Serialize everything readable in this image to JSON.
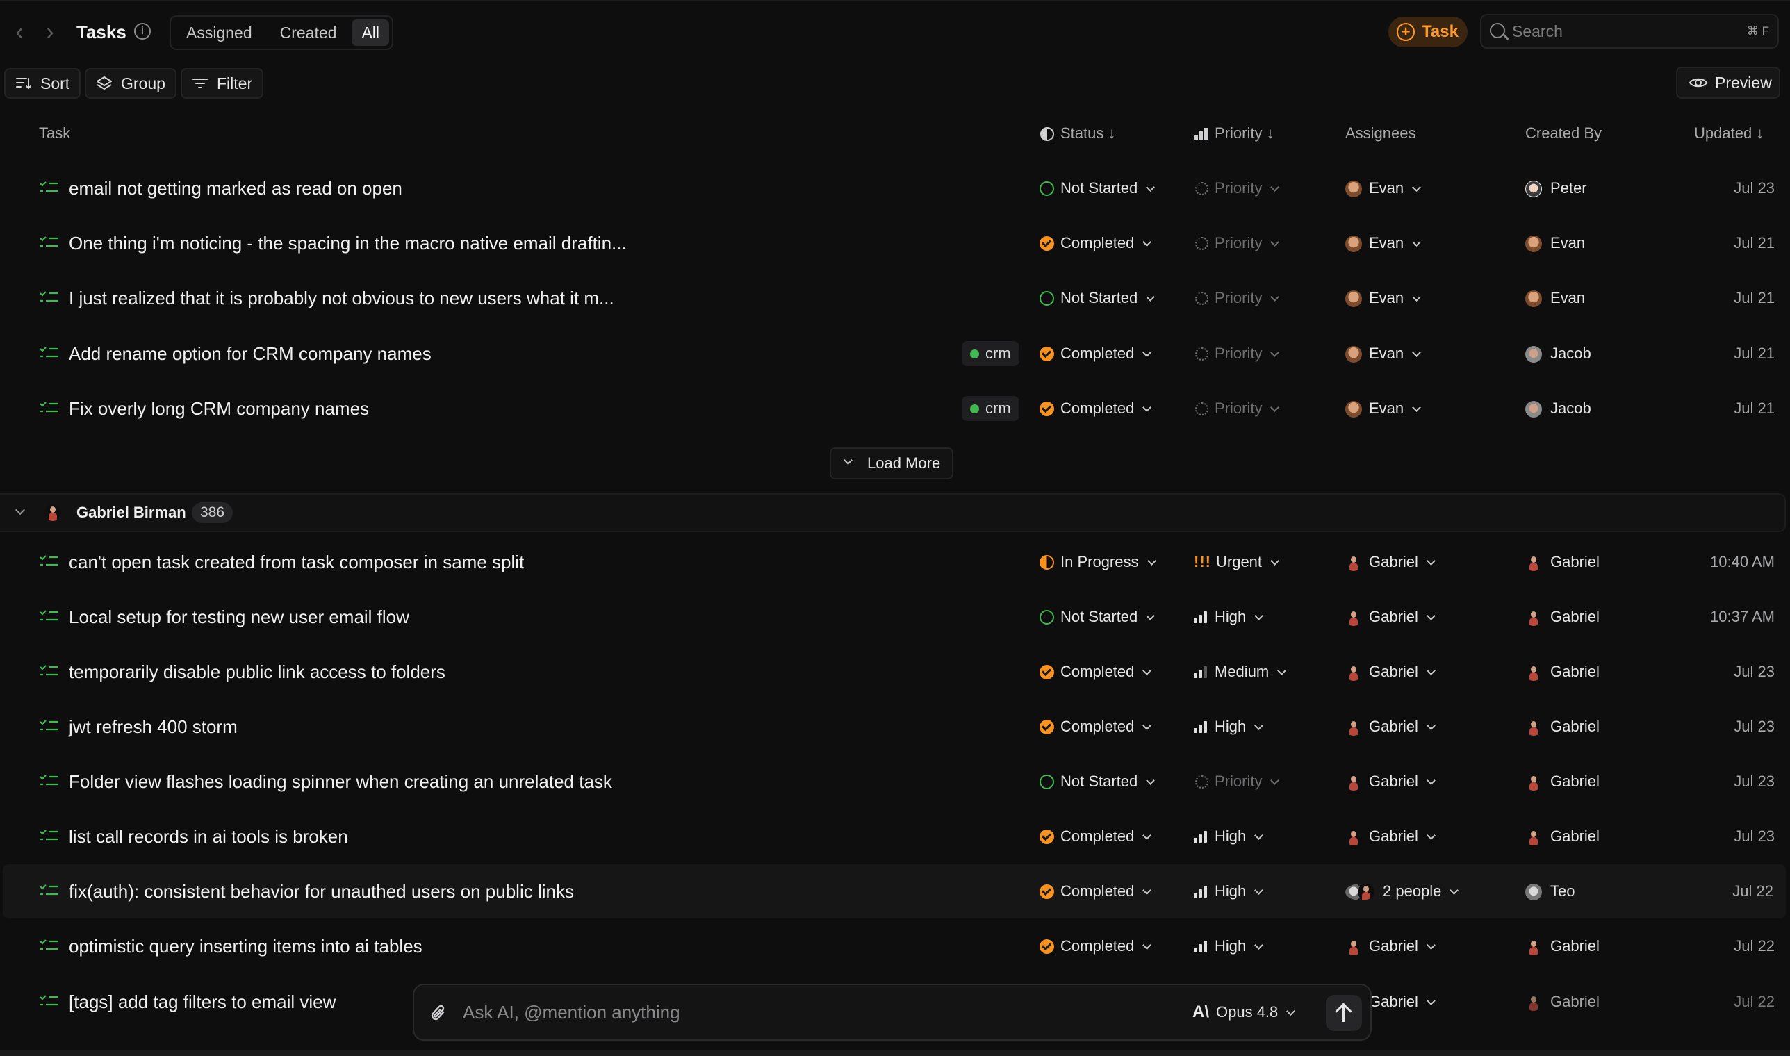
{
  "header": {
    "title": "Tasks",
    "tabs": [
      "Assigned",
      "Created",
      "All"
    ],
    "active_tab": "All",
    "new_task_label": "Task",
    "search_placeholder": "Search",
    "search_shortcut": "⌘ F"
  },
  "toolbar": {
    "sort_label": "Sort",
    "group_label": "Group",
    "filter_label": "Filter",
    "preview_label": "Preview"
  },
  "columns": {
    "task": "Task",
    "status": "Status",
    "priority": "Priority",
    "assignees": "Assignees",
    "created_by": "Created By",
    "updated": "Updated"
  },
  "group1_rows": [
    {
      "title": "email not getting marked as read on open",
      "tag": "",
      "status": "Not Started",
      "priority": "Priority",
      "assignee": "Evan",
      "creator": "Peter",
      "updated": "Jul 23"
    },
    {
      "title": "One thing i'm noticing - the spacing in the macro native email draftin...",
      "tag": "",
      "status": "Completed",
      "priority": "Priority",
      "assignee": "Evan",
      "creator": "Evan",
      "updated": "Jul 21"
    },
    {
      "title": "I just realized that it is probably not obvious to new users what it m...",
      "tag": "",
      "status": "Not Started",
      "priority": "Priority",
      "assignee": "Evan",
      "creator": "Evan",
      "updated": "Jul 21"
    },
    {
      "title": "Add rename option for CRM company names",
      "tag": "crm",
      "status": "Completed",
      "priority": "Priority",
      "assignee": "Evan",
      "creator": "Jacob",
      "updated": "Jul 21"
    },
    {
      "title": "Fix overly long CRM company names",
      "tag": "crm",
      "status": "Completed",
      "priority": "Priority",
      "assignee": "Evan",
      "creator": "Jacob",
      "updated": "Jul 21"
    }
  ],
  "load_more_label": "Load More",
  "group2": {
    "name": "Gabriel Birman",
    "count": "386"
  },
  "group2_rows": [
    {
      "title": "can't open task created from task composer in same split",
      "status": "In Progress",
      "priority_marker": "!!!",
      "priority": "Urgent",
      "assignee": "Gabriel",
      "creator": "Gabriel",
      "updated": "10:40 AM"
    },
    {
      "title": "Local setup for testing new user email flow",
      "status": "Not Started",
      "priority": "High",
      "assignee": "Gabriel",
      "creator": "Gabriel",
      "updated": "10:37 AM"
    },
    {
      "title": "temporarily disable public link access to folders",
      "status": "Completed",
      "priority": "Medium",
      "assignee": "Gabriel",
      "creator": "Gabriel",
      "updated": "Jul 23"
    },
    {
      "title": "jwt refresh 400 storm",
      "status": "Completed",
      "priority": "High",
      "assignee": "Gabriel",
      "creator": "Gabriel",
      "updated": "Jul 23"
    },
    {
      "title": "Folder view flashes loading spinner when creating an unrelated task",
      "status": "Not Started",
      "priority": "Priority",
      "assignee": "Gabriel",
      "creator": "Gabriel",
      "updated": "Jul 23"
    },
    {
      "title": "list call records in ai tools is broken",
      "status": "Completed",
      "priority": "High",
      "assignee": "Gabriel",
      "creator": "Gabriel",
      "updated": "Jul 23"
    },
    {
      "title": "fix(auth): consistent behavior for unauthed users on public links",
      "status": "Completed",
      "priority": "High",
      "assignee": "2 people",
      "creator": "Teo",
      "updated": "Jul 22"
    },
    {
      "title": "optimistic query inserting items into ai tables",
      "status": "Completed",
      "priority": "High",
      "assignee": "Gabriel",
      "creator": "Gabriel",
      "updated": "Jul 22"
    },
    {
      "title": "[tags] add tag filters to email view",
      "status": "",
      "priority": "",
      "assignee": "Gabriel",
      "creator": "Gabriel",
      "updated": "Jul 22"
    }
  ],
  "composer": {
    "placeholder": "Ask AI, @mention anything",
    "model_logo": "A\\",
    "model": "Opus 4.8"
  },
  "colors": {
    "accent_orange": "#f7931e",
    "not_started_green": "#3fb950",
    "background": "#0e0e0f"
  }
}
